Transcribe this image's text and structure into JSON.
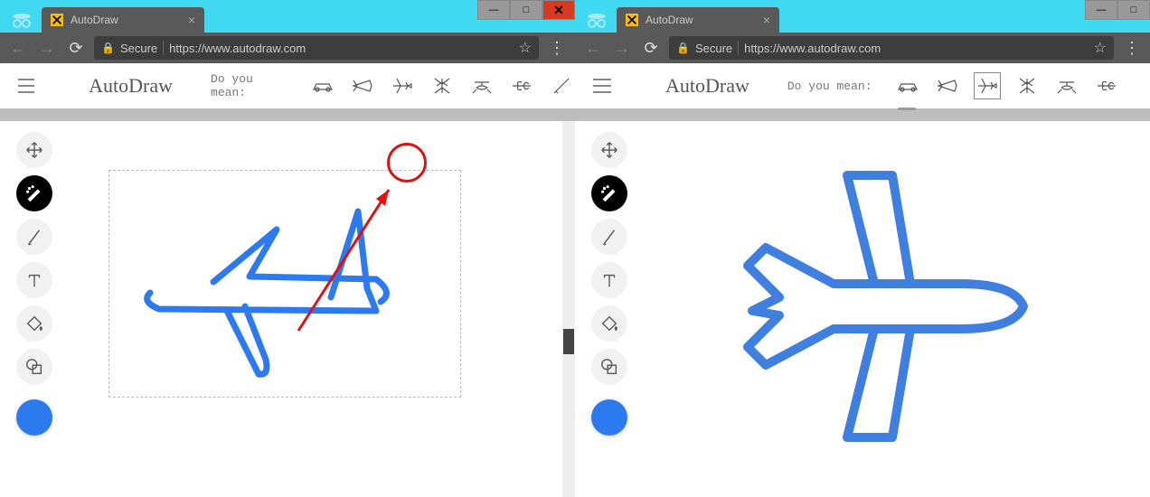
{
  "windows": [
    {
      "tab_title": "AutoDraw",
      "secure_label": "Secure",
      "url": "https://www.autodraw.com",
      "app_title": "AutoDraw",
      "dym_label": "Do you mean:",
      "suggestions": [
        "car",
        "jet",
        "airplane",
        "mosquito",
        "helicopter",
        "dragonfly",
        "knife"
      ],
      "selected_suggestion": null,
      "suggestion_underline": false,
      "annotation": {
        "circle": "airplane",
        "arrow": true
      },
      "tools": [
        "move",
        "autodraw",
        "draw",
        "text",
        "fill",
        "shape"
      ],
      "active_tool": "autodraw",
      "color": "#2d7af0",
      "canvas_content": "hand-drawn-airplane",
      "show_dashed_selection": true,
      "scrollbar": true
    },
    {
      "tab_title": "AutoDraw",
      "secure_label": "Secure",
      "url": "https://www.autodraw.com",
      "app_title": "AutoDraw",
      "dym_label": "Do you mean:",
      "suggestions": [
        "car",
        "jet",
        "airplane",
        "mosquito",
        "helicopter",
        "dragonfly"
      ],
      "selected_suggestion": "airplane",
      "suggestion_underline": true,
      "annotation": null,
      "tools": [
        "move",
        "autodraw",
        "draw",
        "text",
        "fill",
        "shape"
      ],
      "active_tool": "autodraw",
      "color": "#2d7af0",
      "canvas_content": "clean-airplane",
      "show_dashed_selection": false,
      "scrollbar": false
    }
  ]
}
